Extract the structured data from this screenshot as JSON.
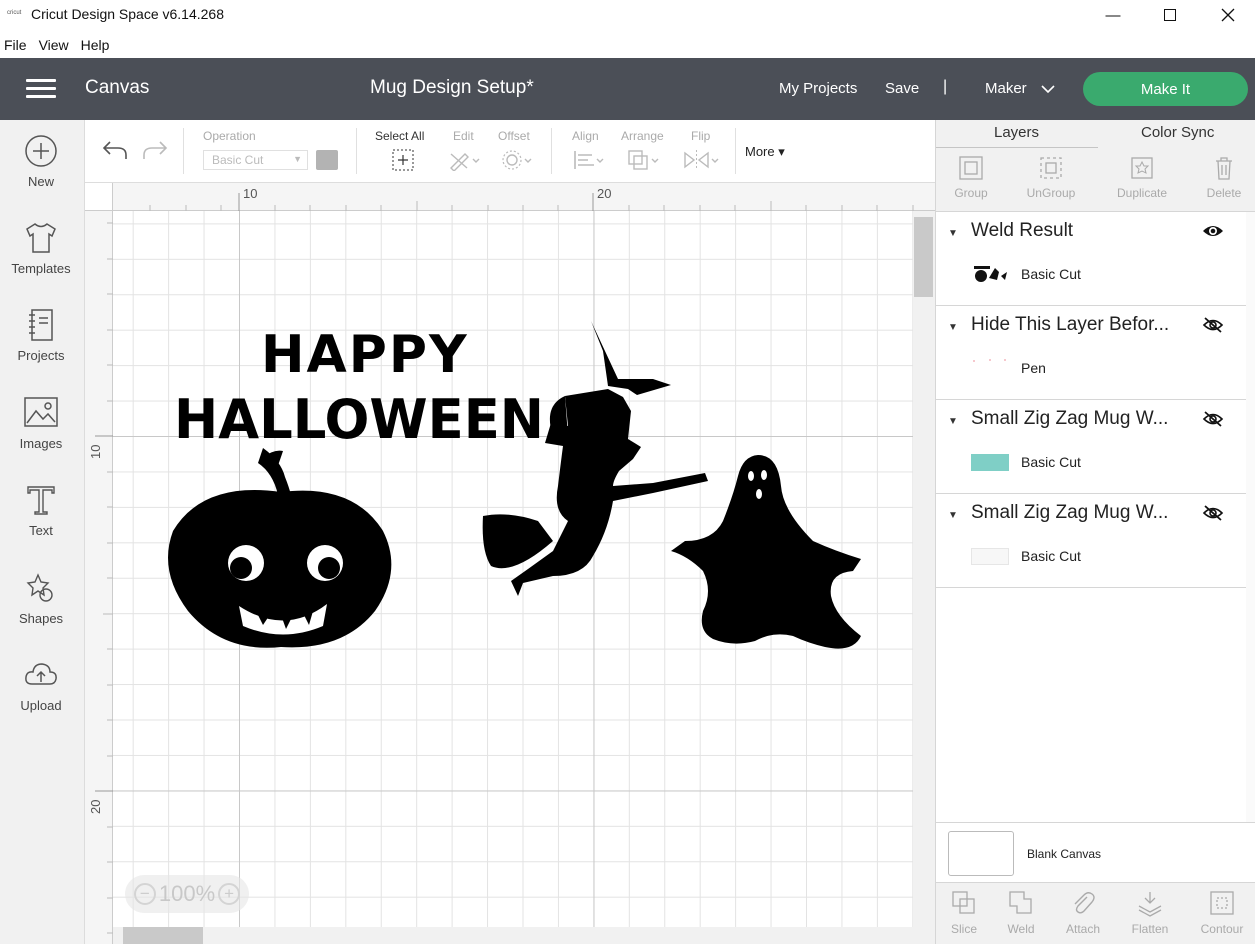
{
  "window": {
    "logo_text": "cricut",
    "title": "Cricut Design Space  v6.14.268",
    "minimize": "—"
  },
  "menu": [
    "File",
    "View",
    "Help"
  ],
  "header": {
    "section": "Canvas",
    "project_name": "Mug Design Setup*",
    "my_projects": "My Projects",
    "save": "Save",
    "separator": "|",
    "machine": "Maker",
    "make_it": "Make It"
  },
  "leftbar": [
    {
      "label": "New",
      "icon": "plus-circle-icon"
    },
    {
      "label": "Templates",
      "icon": "tshirt-icon"
    },
    {
      "label": "Projects",
      "icon": "notebook-icon"
    },
    {
      "label": "Images",
      "icon": "image-icon"
    },
    {
      "label": "Text",
      "icon": "text-t-icon"
    },
    {
      "label": "Shapes",
      "icon": "shapes-icon"
    },
    {
      "label": "Upload",
      "icon": "cloud-upload-icon"
    }
  ],
  "edit_toolbar": {
    "operation_label": "Operation",
    "operation_value": "Basic Cut",
    "select_all": "Select All",
    "edit": "Edit",
    "offset": "Offset",
    "align": "Align",
    "arrange": "Arrange",
    "flip": "Flip",
    "more": "More"
  },
  "rulers": {
    "top": [
      "10",
      "20"
    ],
    "left": [
      "10",
      "20"
    ]
  },
  "canvas": {
    "text_line1": "HAPPY",
    "text_line2": "HALLOWEEN",
    "images": [
      "pumpkin",
      "witch-on-broom",
      "ghost"
    ]
  },
  "zoom": {
    "minus": "−",
    "value": "100%",
    "plus": "+"
  },
  "right_panel": {
    "tabs": [
      "Layers",
      "Color Sync"
    ],
    "tools": [
      "Group",
      "UnGroup",
      "Duplicate",
      "Delete"
    ],
    "layers": [
      {
        "name": "Weld Result",
        "visible": true,
        "sub_label": "Basic Cut",
        "swatch": "image"
      },
      {
        "name": "Hide This Layer Befor...",
        "visible": false,
        "sub_label": "Pen",
        "swatch": "dots"
      },
      {
        "name": "Small Zig Zag Mug W...",
        "visible": false,
        "sub_label": "Basic Cut",
        "swatch": "#7fcfc6"
      },
      {
        "name": "Small Zig Zag Mug W...",
        "visible": false,
        "sub_label": "Basic Cut",
        "swatch": "#f7f7f7"
      }
    ],
    "blank_canvas": "Blank Canvas",
    "bottom_tools": [
      "Slice",
      "Weld",
      "Attach",
      "Flatten",
      "Contour"
    ]
  },
  "colors": {
    "header_bg": "#4b4f57",
    "make_it": "#3aaa6e",
    "layer_teal": "#7fcfc6"
  }
}
